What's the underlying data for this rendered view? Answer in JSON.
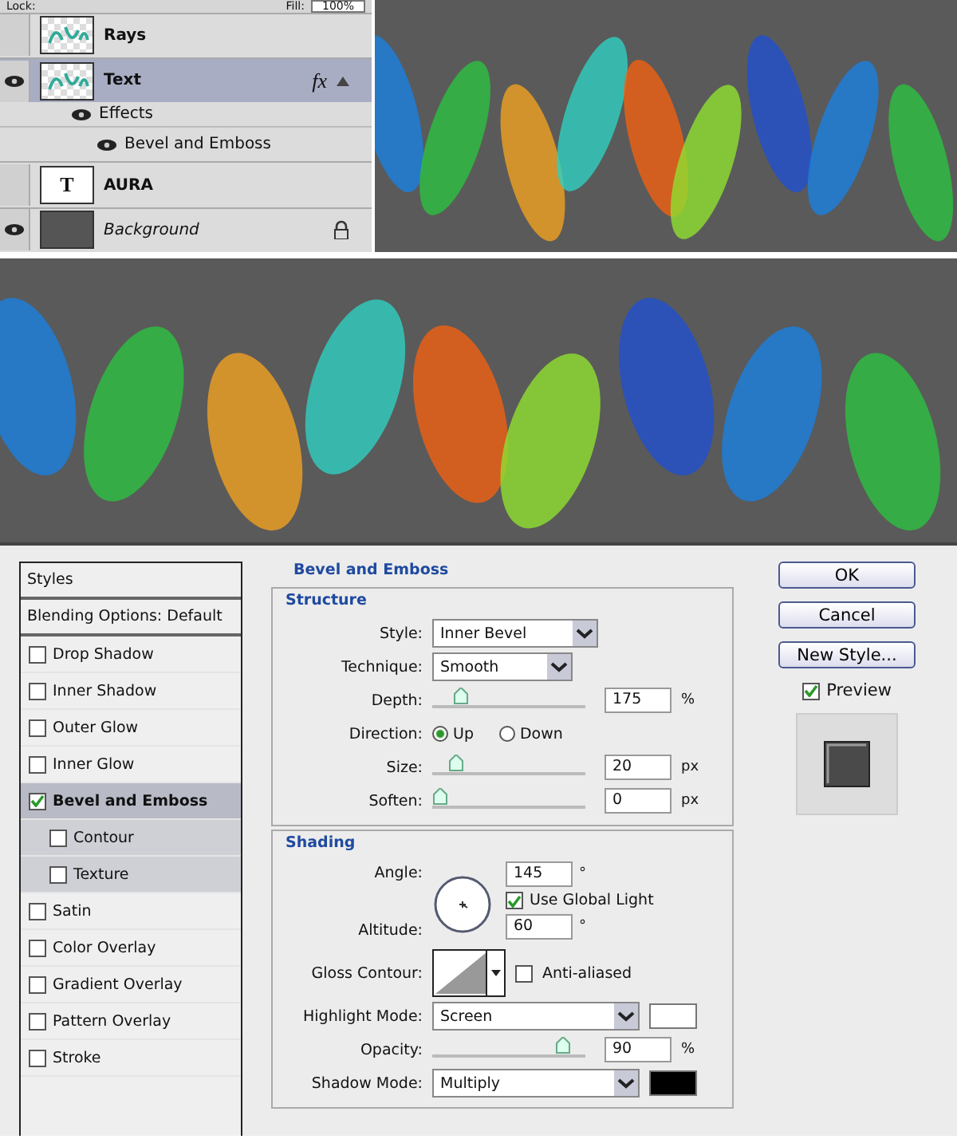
{
  "layers_panel": {
    "lock_label": "Lock:",
    "fill_label": "Fill:",
    "fill_value": "100%",
    "layers": [
      {
        "name": "Rays",
        "kind": "raster",
        "visible": false,
        "selected": false
      },
      {
        "name": "Text",
        "kind": "raster",
        "visible": true,
        "selected": true,
        "badge": "fx",
        "effects": {
          "label": "Effects",
          "items": [
            "Bevel and Emboss"
          ]
        }
      },
      {
        "name": "AURA",
        "kind": "type",
        "thumb_text": "T",
        "visible": false,
        "selected": false
      },
      {
        "name": "Background",
        "kind": "background",
        "visible": true,
        "selected": false,
        "locked": true
      }
    ]
  },
  "layer_style": {
    "styles_header": "Styles",
    "blending": "Blending Options: Default",
    "effects": [
      {
        "label": "Drop Shadow",
        "checked": false,
        "selected": false
      },
      {
        "label": "Inner Shadow",
        "checked": false,
        "selected": false
      },
      {
        "label": "Outer Glow",
        "checked": false,
        "selected": false
      },
      {
        "label": "Inner Glow",
        "checked": false,
        "selected": false
      },
      {
        "label": "Bevel and Emboss",
        "checked": true,
        "selected": true,
        "children": [
          {
            "label": "Contour",
            "checked": false
          },
          {
            "label": "Texture",
            "checked": false
          }
        ]
      },
      {
        "label": "Satin",
        "checked": false,
        "selected": false
      },
      {
        "label": "Color Overlay",
        "checked": false,
        "selected": false
      },
      {
        "label": "Gradient Overlay",
        "checked": false,
        "selected": false
      },
      {
        "label": "Pattern Overlay",
        "checked": false,
        "selected": false
      },
      {
        "label": "Stroke",
        "checked": false,
        "selected": false
      }
    ],
    "title": "Bevel and Emboss",
    "groups": [
      {
        "title": "Structure",
        "rows": [
          {
            "kind": "select",
            "label": "Style:",
            "value": "Inner Bevel"
          },
          {
            "kind": "select",
            "label": "Technique:",
            "value": "Smooth"
          },
          {
            "kind": "slider",
            "label": "Depth:",
            "level": 0.15,
            "value": "175",
            "unit": "%"
          },
          {
            "kind": "radio",
            "label": "Direction:",
            "options": [
              {
                "label": "Up",
                "selected": true
              },
              {
                "label": "Down",
                "selected": false
              }
            ]
          },
          {
            "kind": "slider",
            "label": "Size:",
            "level": 0.12,
            "value": "20",
            "unit": "px"
          },
          {
            "kind": "slider",
            "label": "Soften:",
            "level": 0,
            "value": "0",
            "unit": "px"
          }
        ]
      },
      {
        "title": "Shading",
        "rows": [
          {
            "kind": "angle",
            "label": "Angle:",
            "value": "145",
            "unit": "°",
            "global_label": "Use Global Light",
            "global_checked": true,
            "altitude_label": "Altitude:",
            "altitude_value": "60",
            "altitude_unit": "°"
          },
          {
            "kind": "contour",
            "label": "Gloss Contour:",
            "option_label": "Anti-aliased",
            "option_checked": false
          },
          {
            "kind": "select",
            "label": "Highlight Mode:",
            "value": "Screen",
            "color": "#ffffff"
          },
          {
            "kind": "slider",
            "label": "Opacity:",
            "level": 0.9,
            "value": "90",
            "unit": "%"
          },
          {
            "kind": "select",
            "label": "Shadow Mode:",
            "value": "Multiply",
            "color": "#000000"
          }
        ]
      }
    ],
    "buttons": [
      "OK",
      "Cancel",
      "New Style..."
    ],
    "preview_label": "Preview",
    "preview_checked": true
  }
}
